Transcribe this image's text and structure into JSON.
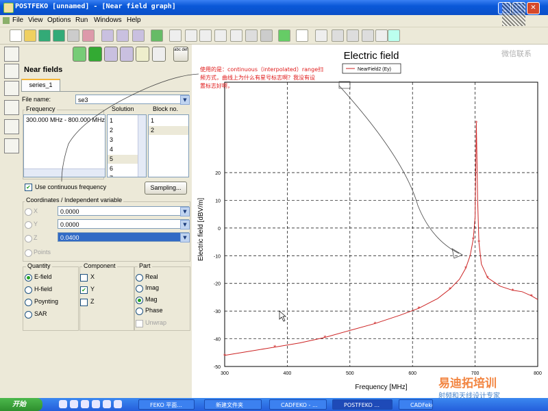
{
  "window": {
    "title": "POSTFEKO [unnamed] - [Near field graph]"
  },
  "menu": [
    "File",
    "View",
    "Options",
    "Run",
    "Windows",
    "Help"
  ],
  "toolbar_icons": [
    "new-icon",
    "open-icon",
    "save-icon",
    "save-as-icon",
    "print-icon",
    "export-icon",
    "model-icon",
    "results-icon",
    "optimization-icon",
    "3d-view-icon",
    "graph-icon",
    "e-field-icon",
    "sar-icon",
    "power-icon",
    "chart-icon",
    "map-icon",
    "image-icon",
    "contour-icon",
    "smith-chart-icon",
    "output-icon",
    "cadfeko-icon",
    "editfeko-icon",
    "wizard-icon",
    "table-icon",
    "target-icon"
  ],
  "panel": {
    "title": "Near fields",
    "tab": "series_1",
    "file_name_label": "File name:",
    "file_name_value": "se3",
    "frequency_label": "Frequency",
    "frequency_items": [
      "300.000 MHz - 800.000 MHz"
    ],
    "solution_label": "Solution",
    "solution_items": [
      "1",
      "2",
      "3",
      "4",
      "5",
      "6",
      "7"
    ],
    "block_label": "Block no.",
    "block_items": [
      "1",
      "2"
    ],
    "continuous_label": "Use continuous frequency",
    "sampling_button": "Sampling...",
    "coordinates_label": "Coordinates / Independent variable",
    "coords": [
      {
        "axis": "X",
        "value": "0.0000"
      },
      {
        "axis": "Y",
        "value": "0.0000"
      },
      {
        "axis": "Z",
        "value": "0.0400"
      }
    ],
    "points_label": "Points",
    "quantity_label": "Quantity",
    "quantity_items": [
      "E-field",
      "H-field",
      "Poynting",
      "SAR"
    ],
    "component_label": "Component",
    "component_items": [
      "X",
      "Y",
      "Z"
    ],
    "part_label": "Part",
    "part_items": [
      "Real",
      "Imag",
      "Mag",
      "Phase"
    ],
    "unwrap_label": "Unwrap",
    "tool_buttons": [
      "delete-icon",
      "add-icon",
      "edit-icon",
      "copy-icon",
      "import-icon",
      "sum-icon",
      "abc-def-icon"
    ],
    "abc_label": "abc def"
  },
  "annotation": {
    "line1": "使用的是：continuous（interpolated）range扫",
    "line2": "频方式，曲线上为什么有星号标志啊？我没有设",
    "line3": "置标志好啊，"
  },
  "watermark": {
    "top_right": "微信联系",
    "bottom_right_1": "易迪拓培训",
    "bottom_right_2": "射频和天线设计专家"
  },
  "chart_data": {
    "type": "line",
    "title": "Electric field",
    "xlabel": "Frequency [MHz]",
    "ylabel": "Electric field [dBV/m]",
    "xlim": [
      300,
      800
    ],
    "ylim": [
      -50,
      20
    ],
    "xticks": [
      300,
      400,
      500,
      600,
      700,
      800
    ],
    "yticks": [
      20,
      10,
      0,
      -10,
      -20,
      -30,
      -40,
      -50
    ],
    "legend_position": "top-right",
    "grid": true,
    "series": [
      {
        "name": "NearField2 (Ey)",
        "color": "#cc2222",
        "x": [
          300,
          340,
          380,
          420,
          460,
          500,
          540,
          580,
          610,
          640,
          660,
          675,
          685,
          692,
          697,
          700,
          702,
          704,
          706,
          710,
          720,
          740,
          760,
          775,
          790,
          800
        ],
        "y": [
          -46,
          -44.5,
          -43,
          -41.5,
          -39.5,
          -37,
          -34.5,
          -31.5,
          -29,
          -25.5,
          -22,
          -18.5,
          -14.5,
          -10,
          -4,
          4,
          38,
          10,
          -5,
          -13,
          -18,
          -21,
          -22.5,
          -23,
          -24.5,
          -25.8
        ]
      }
    ]
  },
  "taskbar": {
    "start": "开始",
    "items": [
      {
        "label": "FEKO 平面...",
        "active": false
      },
      {
        "label": "新建文件夹",
        "active": false
      },
      {
        "label": "CADFEKO - ...",
        "active": false
      },
      {
        "label": "POSTFEKO ...",
        "active": true
      },
      {
        "label": "CADFeko ...",
        "active": false
      }
    ]
  }
}
